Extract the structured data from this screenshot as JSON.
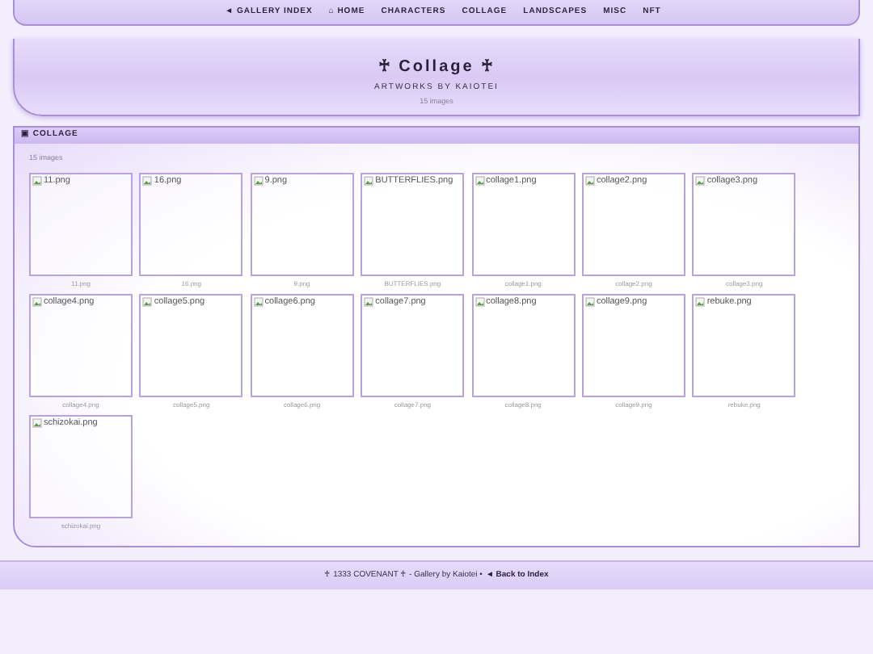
{
  "nav": [
    {
      "label": "◄ GALLERY INDEX"
    },
    {
      "label": "⌂ HOME"
    },
    {
      "label": "CHARACTERS"
    },
    {
      "label": "COLLAGE"
    },
    {
      "label": "LANDSCAPES"
    },
    {
      "label": "MISC"
    },
    {
      "label": "NFT"
    }
  ],
  "header": {
    "title": "♰ Collage ♰",
    "subtitle": "ARTWORKS BY KAIOTEI",
    "count": "15 images"
  },
  "gallery": {
    "heading": "▣ COLLAGE",
    "count": "15 images",
    "images": [
      {
        "alt": "11.png",
        "caption": "11.png"
      },
      {
        "alt": "16.png",
        "caption": "16.png"
      },
      {
        "alt": "9.png",
        "caption": "9.png"
      },
      {
        "alt": "BUTTERFLIES.png",
        "caption": "BUTTERFLIES.png"
      },
      {
        "alt": "collage1.png",
        "caption": "collage1.png"
      },
      {
        "alt": "collage2.png",
        "caption": "collage2.png"
      },
      {
        "alt": "collage3.png",
        "caption": "collage3.png"
      },
      {
        "alt": "collage4.png",
        "caption": "collage4.png"
      },
      {
        "alt": "collage5.png",
        "caption": "collage5.png"
      },
      {
        "alt": "collage6.png",
        "caption": "collage6.png"
      },
      {
        "alt": "collage7.png",
        "caption": "collage7.png"
      },
      {
        "alt": "collage8.png",
        "caption": "collage8.png"
      },
      {
        "alt": "collage9.png",
        "caption": "collage9.png"
      },
      {
        "alt": "rebuke.png",
        "caption": "rebuke.png"
      },
      {
        "alt": "schizokai.png",
        "caption": "schizokai.png"
      }
    ]
  },
  "footer": {
    "text": "♰ 1333 COVENANT ♰ - Gallery by Kaiotei •",
    "link": "◄ Back to Index"
  }
}
